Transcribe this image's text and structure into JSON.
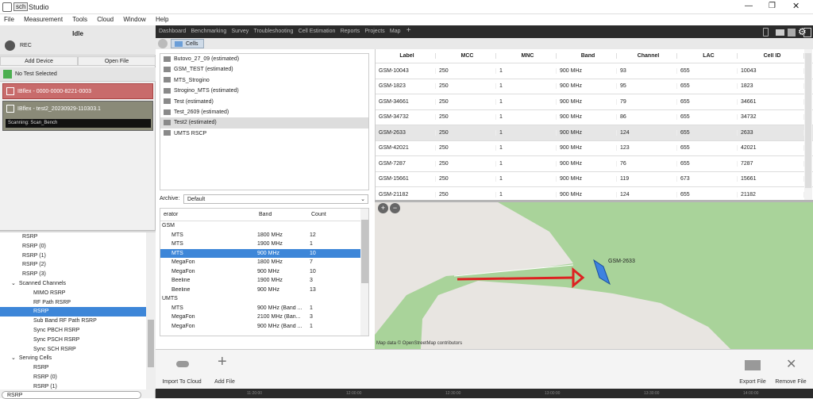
{
  "app": {
    "title": "Studio",
    "logo": "sch"
  },
  "menu": [
    "File",
    "Measurement",
    "Tools",
    "Cloud",
    "Window",
    "Help"
  ],
  "status": {
    "idle": "Idle",
    "rec": "REC"
  },
  "left_buttons": {
    "add_device": "Add Device",
    "open_file": "Open File"
  },
  "no_test": "No Test Selected",
  "devices": [
    {
      "name": "IBflex - 0000-0000-8221-0003"
    },
    {
      "name": "IBflex - test2_20230929-110303.1"
    }
  ],
  "scanning": "Scanning: Scan_Bench",
  "tree": [
    {
      "label": "RSRP",
      "indent": 2
    },
    {
      "label": "RSRP (0)",
      "indent": 2
    },
    {
      "label": "RSRP (1)",
      "indent": 2
    },
    {
      "label": "RSRP (2)",
      "indent": 2
    },
    {
      "label": "RSRP (3)",
      "indent": 2
    },
    {
      "label": "Scanned Channels",
      "indent": 1,
      "toggle": "v"
    },
    {
      "label": "MIMO RSRP",
      "indent": 3
    },
    {
      "label": "RF Path RSRP",
      "indent": 3
    },
    {
      "label": "RSRP",
      "indent": 3,
      "selected": true
    },
    {
      "label": "Sub Band RF Path RSRP",
      "indent": 3
    },
    {
      "label": "Sync PBCH RSRP",
      "indent": 3
    },
    {
      "label": "Sync PSCH RSRP",
      "indent": 3
    },
    {
      "label": "Sync SCH RSRP",
      "indent": 3
    },
    {
      "label": "Serving Cells",
      "indent": 1,
      "toggle": "v"
    },
    {
      "label": "RSRP",
      "indent": 3
    },
    {
      "label": "RSRP (0)",
      "indent": 3
    },
    {
      "label": "RSRP (1)",
      "indent": 3
    }
  ],
  "search_value": "RSRP",
  "tabs": [
    "Dashboard",
    "Benchmarking",
    "Survey",
    "Troubleshooting",
    "Cell Estimation",
    "Reports",
    "Projects",
    "Map"
  ],
  "tab_add": "+",
  "crumb": "Cells",
  "files": [
    "Butovo_27_09 (estimated)",
    "GSM_TEST (estimated)",
    "MTS_Strogino",
    "Strogino_MTS (estimated)",
    "Test (estimated)",
    "Test_2609 (estimated)",
    "Test2 (estimated)",
    "UMTS RSCP"
  ],
  "archive": {
    "label": "Archive:",
    "value": "Default"
  },
  "op_table": {
    "headers": [
      "erator",
      "Band",
      "Count"
    ],
    "rows": [
      {
        "c": [
          "GSM",
          "",
          ""
        ],
        "group": true
      },
      {
        "c": [
          "MTS",
          "1800 MHz",
          "12"
        ]
      },
      {
        "c": [
          "MTS",
          "1900 MHz",
          "1"
        ]
      },
      {
        "c": [
          "MTS",
          "900 MHz",
          "10"
        ],
        "selected": true
      },
      {
        "c": [
          "MegaFon",
          "1800 MHz",
          "7"
        ]
      },
      {
        "c": [
          "MegaFon",
          "900 MHz",
          "10"
        ]
      },
      {
        "c": [
          "Beeline",
          "1900 MHz",
          "3"
        ]
      },
      {
        "c": [
          "Beeline",
          "900 MHz",
          "13"
        ]
      },
      {
        "c": [
          "UMTS",
          "",
          ""
        ],
        "group": true
      },
      {
        "c": [
          "MTS",
          "900 MHz (Band ...",
          "1"
        ]
      },
      {
        "c": [
          "MegaFon",
          "2100 MHz (Ban...",
          "3"
        ]
      },
      {
        "c": [
          "MegaFon",
          "900 MHz (Band ...",
          "1"
        ]
      }
    ]
  },
  "cells_table": {
    "headers": [
      "Label",
      "MCC",
      "MNC",
      "Band",
      "Channel",
      "LAC",
      "Cell ID"
    ],
    "rows": [
      [
        "GSM-10043",
        "250",
        "1",
        "900 MHz",
        "93",
        "655",
        "10043"
      ],
      [
        "GSM-1823",
        "250",
        "1",
        "900 MHz",
        "95",
        "655",
        "1823"
      ],
      [
        "GSM-34661",
        "250",
        "1",
        "900 MHz",
        "79",
        "655",
        "34661"
      ],
      [
        "GSM-34732",
        "250",
        "1",
        "900 MHz",
        "86",
        "655",
        "34732"
      ],
      [
        "GSM-2633",
        "250",
        "1",
        "900 MHz",
        "124",
        "655",
        "2633"
      ],
      [
        "GSM-42021",
        "250",
        "1",
        "900 MHz",
        "123",
        "655",
        "42021"
      ],
      [
        "GSM-7287",
        "250",
        "1",
        "900 MHz",
        "76",
        "655",
        "7287"
      ],
      [
        "GSM-15661",
        "250",
        "1",
        "900 MHz",
        "119",
        "673",
        "15661"
      ],
      [
        "GSM-21182",
        "250",
        "1",
        "900 MHz",
        "124",
        "655",
        "21182"
      ]
    ]
  },
  "map": {
    "cell_label": "GSM-2633",
    "attribution": "Map data © OpenStreetMap contributors",
    "zoom_in": "+",
    "zoom_out": "−"
  },
  "bottom": {
    "import": "Import To Cloud",
    "add": "Add File",
    "export": "Export File",
    "remove": "Remove File"
  },
  "timeline": [
    "11:20:00",
    "12:00:00",
    "12:30:00",
    "13:00:00",
    "13:30:00",
    "14:00:00"
  ]
}
